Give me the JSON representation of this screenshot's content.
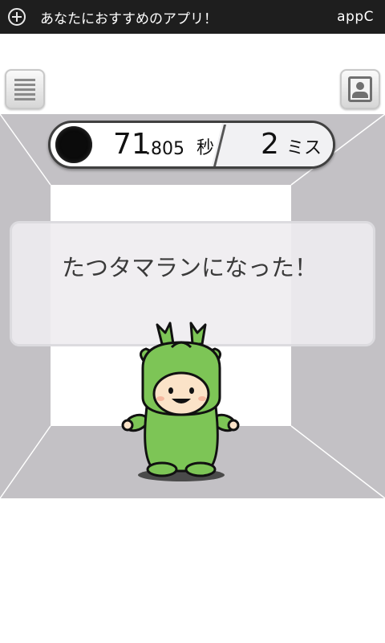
{
  "ad_banner": {
    "message": "あなたにおすすめのアプリ！",
    "brand": "appC"
  },
  "score": {
    "time_integer": "71",
    "time_fraction": ".805",
    "time_unit": "秒",
    "miss_count": "2",
    "miss_unit": "ミス"
  },
  "result": {
    "message": "たつタマランになった！"
  },
  "icons": {
    "menu": "menu-icon",
    "photo": "photo-icon",
    "add": "plus-icon"
  },
  "colors": {
    "banner_bg": "#1e1e1e",
    "room_floor": "#c3c1c5",
    "room_back_wall": "#ffffff",
    "mascot_green": "#7dc556"
  }
}
